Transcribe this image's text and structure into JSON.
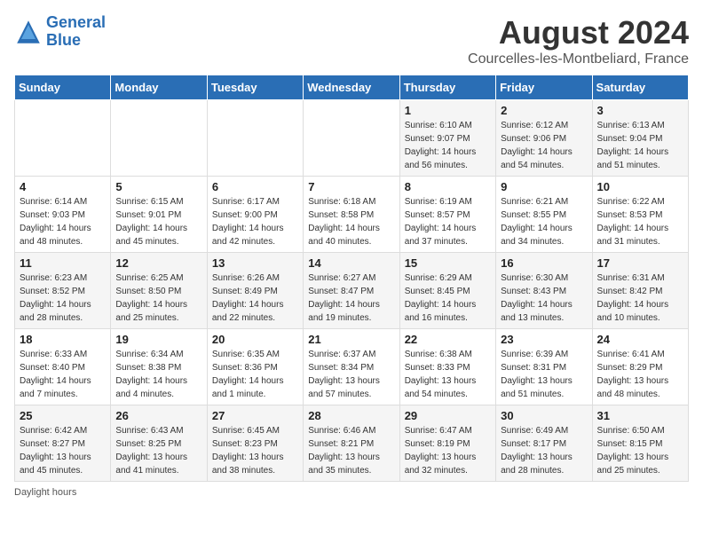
{
  "logo": {
    "line1": "General",
    "line2": "Blue"
  },
  "title": "August 2024",
  "location": "Courcelles-les-Montbeliard, France",
  "days_of_week": [
    "Sunday",
    "Monday",
    "Tuesday",
    "Wednesday",
    "Thursday",
    "Friday",
    "Saturday"
  ],
  "weeks": [
    [
      {
        "day": "",
        "info": ""
      },
      {
        "day": "",
        "info": ""
      },
      {
        "day": "",
        "info": ""
      },
      {
        "day": "",
        "info": ""
      },
      {
        "day": "1",
        "info": "Sunrise: 6:10 AM\nSunset: 9:07 PM\nDaylight: 14 hours and 56 minutes."
      },
      {
        "day": "2",
        "info": "Sunrise: 6:12 AM\nSunset: 9:06 PM\nDaylight: 14 hours and 54 minutes."
      },
      {
        "day": "3",
        "info": "Sunrise: 6:13 AM\nSunset: 9:04 PM\nDaylight: 14 hours and 51 minutes."
      }
    ],
    [
      {
        "day": "4",
        "info": "Sunrise: 6:14 AM\nSunset: 9:03 PM\nDaylight: 14 hours and 48 minutes."
      },
      {
        "day": "5",
        "info": "Sunrise: 6:15 AM\nSunset: 9:01 PM\nDaylight: 14 hours and 45 minutes."
      },
      {
        "day": "6",
        "info": "Sunrise: 6:17 AM\nSunset: 9:00 PM\nDaylight: 14 hours and 42 minutes."
      },
      {
        "day": "7",
        "info": "Sunrise: 6:18 AM\nSunset: 8:58 PM\nDaylight: 14 hours and 40 minutes."
      },
      {
        "day": "8",
        "info": "Sunrise: 6:19 AM\nSunset: 8:57 PM\nDaylight: 14 hours and 37 minutes."
      },
      {
        "day": "9",
        "info": "Sunrise: 6:21 AM\nSunset: 8:55 PM\nDaylight: 14 hours and 34 minutes."
      },
      {
        "day": "10",
        "info": "Sunrise: 6:22 AM\nSunset: 8:53 PM\nDaylight: 14 hours and 31 minutes."
      }
    ],
    [
      {
        "day": "11",
        "info": "Sunrise: 6:23 AM\nSunset: 8:52 PM\nDaylight: 14 hours and 28 minutes."
      },
      {
        "day": "12",
        "info": "Sunrise: 6:25 AM\nSunset: 8:50 PM\nDaylight: 14 hours and 25 minutes."
      },
      {
        "day": "13",
        "info": "Sunrise: 6:26 AM\nSunset: 8:49 PM\nDaylight: 14 hours and 22 minutes."
      },
      {
        "day": "14",
        "info": "Sunrise: 6:27 AM\nSunset: 8:47 PM\nDaylight: 14 hours and 19 minutes."
      },
      {
        "day": "15",
        "info": "Sunrise: 6:29 AM\nSunset: 8:45 PM\nDaylight: 14 hours and 16 minutes."
      },
      {
        "day": "16",
        "info": "Sunrise: 6:30 AM\nSunset: 8:43 PM\nDaylight: 14 hours and 13 minutes."
      },
      {
        "day": "17",
        "info": "Sunrise: 6:31 AM\nSunset: 8:42 PM\nDaylight: 14 hours and 10 minutes."
      }
    ],
    [
      {
        "day": "18",
        "info": "Sunrise: 6:33 AM\nSunset: 8:40 PM\nDaylight: 14 hours and 7 minutes."
      },
      {
        "day": "19",
        "info": "Sunrise: 6:34 AM\nSunset: 8:38 PM\nDaylight: 14 hours and 4 minutes."
      },
      {
        "day": "20",
        "info": "Sunrise: 6:35 AM\nSunset: 8:36 PM\nDaylight: 14 hours and 1 minute."
      },
      {
        "day": "21",
        "info": "Sunrise: 6:37 AM\nSunset: 8:34 PM\nDaylight: 13 hours and 57 minutes."
      },
      {
        "day": "22",
        "info": "Sunrise: 6:38 AM\nSunset: 8:33 PM\nDaylight: 13 hours and 54 minutes."
      },
      {
        "day": "23",
        "info": "Sunrise: 6:39 AM\nSunset: 8:31 PM\nDaylight: 13 hours and 51 minutes."
      },
      {
        "day": "24",
        "info": "Sunrise: 6:41 AM\nSunset: 8:29 PM\nDaylight: 13 hours and 48 minutes."
      }
    ],
    [
      {
        "day": "25",
        "info": "Sunrise: 6:42 AM\nSunset: 8:27 PM\nDaylight: 13 hours and 45 minutes."
      },
      {
        "day": "26",
        "info": "Sunrise: 6:43 AM\nSunset: 8:25 PM\nDaylight: 13 hours and 41 minutes."
      },
      {
        "day": "27",
        "info": "Sunrise: 6:45 AM\nSunset: 8:23 PM\nDaylight: 13 hours and 38 minutes."
      },
      {
        "day": "28",
        "info": "Sunrise: 6:46 AM\nSunset: 8:21 PM\nDaylight: 13 hours and 35 minutes."
      },
      {
        "day": "29",
        "info": "Sunrise: 6:47 AM\nSunset: 8:19 PM\nDaylight: 13 hours and 32 minutes."
      },
      {
        "day": "30",
        "info": "Sunrise: 6:49 AM\nSunset: 8:17 PM\nDaylight: 13 hours and 28 minutes."
      },
      {
        "day": "31",
        "info": "Sunrise: 6:50 AM\nSunset: 8:15 PM\nDaylight: 13 hours and 25 minutes."
      }
    ]
  ],
  "footer": "Daylight hours"
}
